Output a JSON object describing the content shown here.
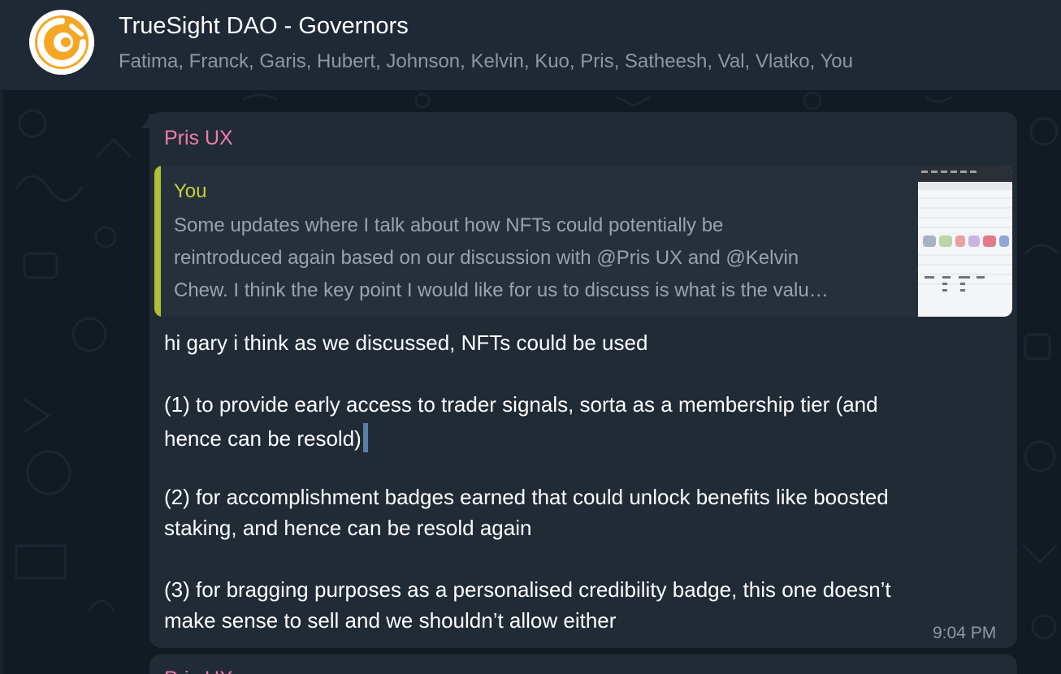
{
  "chat": {
    "title": "TrueSight DAO - Governors",
    "members": "Fatima, Franck, Garis, Hubert, Johnson, Kelvin, Kuo, Pris, Satheesh, Val, Vlatko, You",
    "avatar_icon": "truesight-logo-icon"
  },
  "message": {
    "sender": "Pris UX",
    "reply": {
      "author": "You",
      "lines": [
        "Some updates where I talk about how NFTs could potentially be",
        "reintroduced again based on our discussion with @Pris UX  and @Kelvin",
        "Chew. I think the key point I would like for us to discuss is what is the valu…"
      ],
      "thumbnail_icon": "spreadsheet-thumbnail"
    },
    "lines": [
      "hi gary i think as we discussed, NFTs could be used",
      "(1) to provide early access to trader signals, sorta as a membership tier (and",
      "hence can be resold)",
      "(2) for accomplishment badges earned that could unlock benefits like boosted",
      "staking, and hence can be resold again",
      "(3) for bragging purposes as a personalised credibility badge, this one doesn’t",
      "make sense to sell and we shouldn’t allow either"
    ],
    "time": "9:04 PM"
  },
  "next_message": {
    "sender": "Pris UX"
  },
  "colors": {
    "header_bg": "#1f2936",
    "chat_bg": "#121b24",
    "bubble_bg": "#202b36",
    "sender_color": "#f07bab",
    "reply_bar": "#b4bd33",
    "avatar_accent": "#f5a623"
  }
}
